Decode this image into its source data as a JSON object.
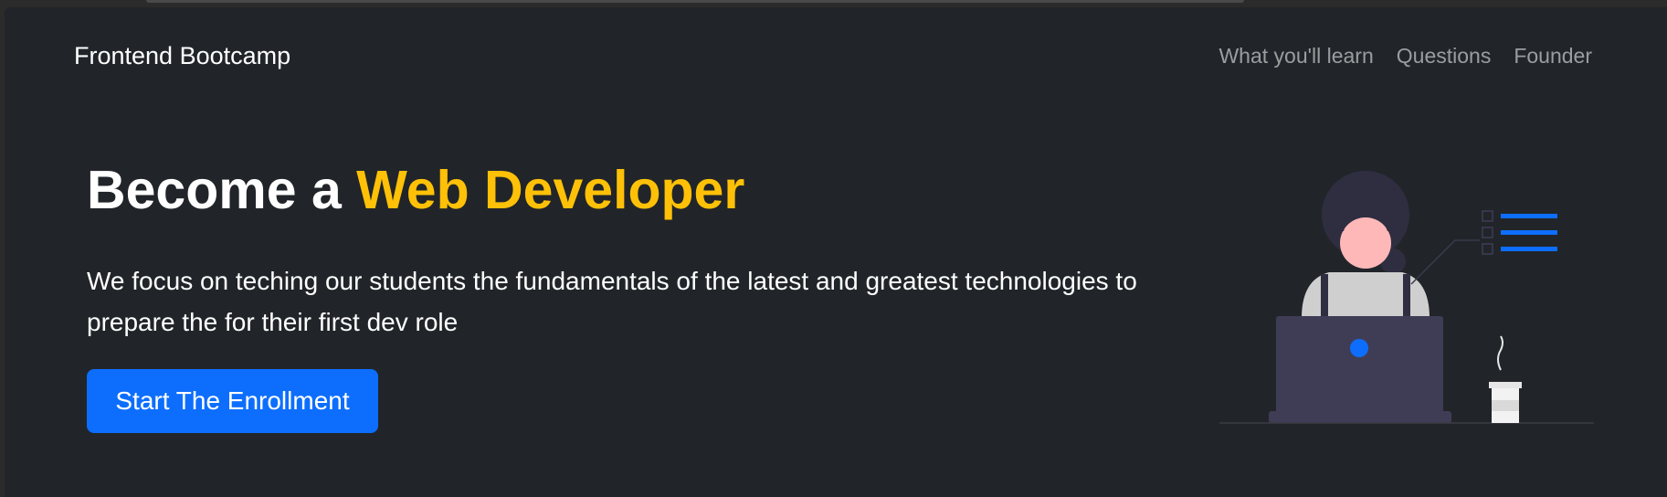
{
  "navbar": {
    "brand": "Frontend Bootcamp",
    "links": [
      "What you'll learn",
      "Questions",
      "Founder"
    ]
  },
  "hero": {
    "title_prefix": "Become a ",
    "title_accent": "Web Developer",
    "lead": "We focus on teching our students the fundamentals of the latest and greatest technologies to prepare the for their first dev role",
    "cta_label": "Start The Enrollment"
  },
  "colors": {
    "page_bg": "#212529",
    "accent_yellow": "#ffc107",
    "primary_blue": "#0d6efd",
    "nav_link_muted": "rgba(255,255,255,0.55)"
  },
  "illustration": {
    "description_icon": "woman-laptop-illustration"
  }
}
